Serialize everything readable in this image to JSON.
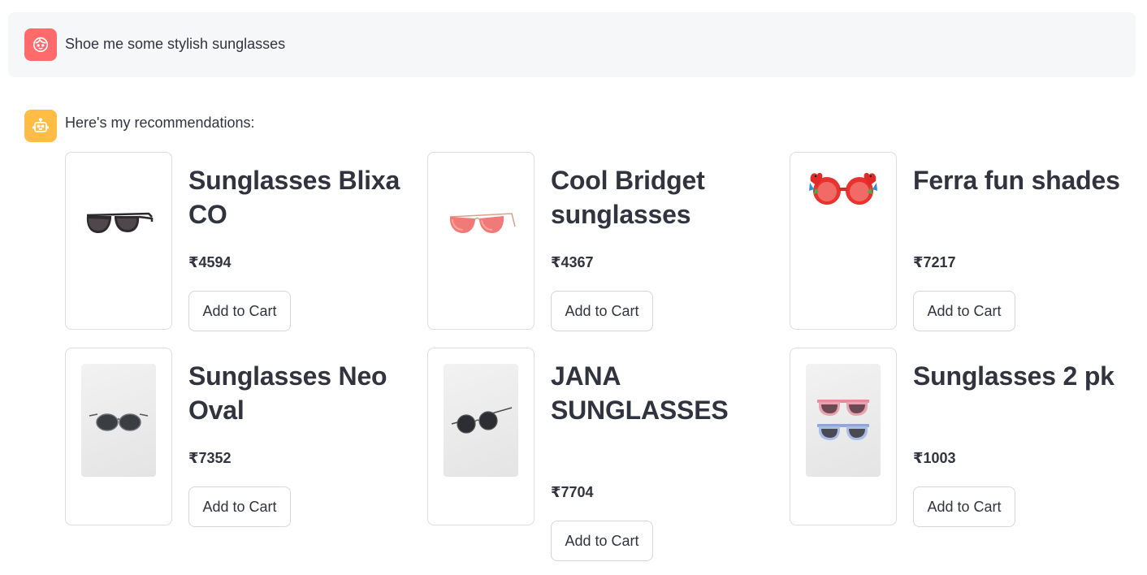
{
  "user_message": {
    "text": "Shoe me some stylish sunglasses",
    "avatar_icon": "user-face-icon",
    "avatar_color": "#ff6b6b"
  },
  "assistant_message": {
    "text": "Here's my recommendations:",
    "avatar_icon": "robot-icon",
    "avatar_color": "#ffbd45"
  },
  "products": [
    {
      "name": "Sunglasses Blixa CO",
      "price": "₹4594",
      "button_label": "Add to Cart",
      "image_icon": "aviator-sunglasses-icon"
    },
    {
      "name": "Cool Bridget sunglasses",
      "price": "₹4367",
      "button_label": "Add to Cart",
      "image_icon": "cat-eye-sunglasses-icon"
    },
    {
      "name": "Ferra fun shades",
      "price": "₹7217",
      "button_label": "Add to Cart",
      "image_icon": "parrot-sunglasses-icon"
    },
    {
      "name": "Sunglasses Neo Oval",
      "price": "₹7352",
      "button_label": "Add to Cart",
      "image_icon": "oval-sunglasses-icon"
    },
    {
      "name": "JANA SUNGLASSES",
      "price": "₹7704",
      "button_label": "Add to Cart",
      "image_icon": "round-sunglasses-icon"
    },
    {
      "name": "Sunglasses 2 pk",
      "price": "₹1003",
      "button_label": "Add to Cart",
      "image_icon": "sunglasses-pair-icon"
    }
  ]
}
